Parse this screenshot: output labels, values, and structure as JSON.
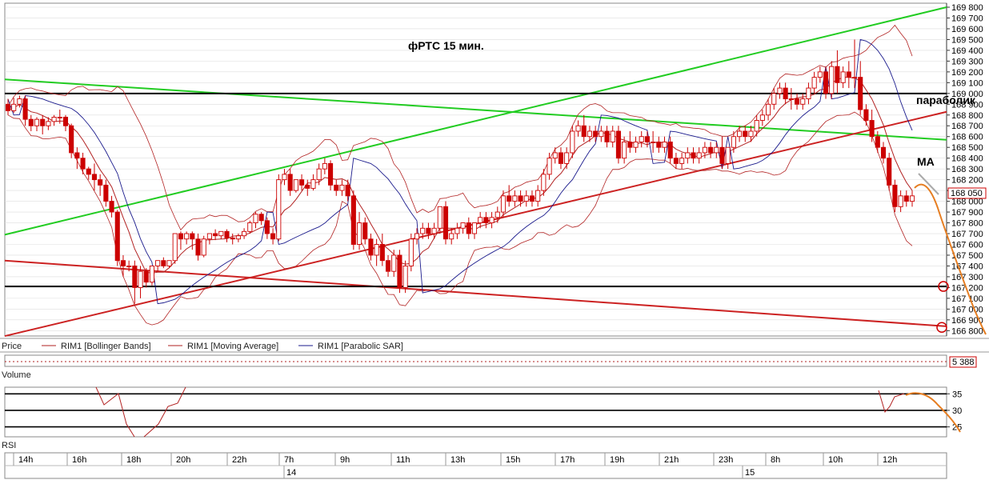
{
  "chart_data": {
    "type": "candlestick",
    "title": "фРТС   15 мин.",
    "price_axis": {
      "ticks": [
        "169 800",
        "169 700",
        "169 600",
        "169 500",
        "169 400",
        "169 300",
        "169 200",
        "169 100",
        "169 000",
        "168 900",
        "168 800",
        "168 700",
        "168 600",
        "168 500",
        "168 400",
        "168 300",
        "168 200",
        "168 100",
        "168 000",
        "167 900",
        "167 800",
        "167 700",
        "167 600",
        "167 500",
        "167 400",
        "167 300",
        "167 200",
        "167 100",
        "167 000",
        "166 900",
        "166 800"
      ],
      "range": [
        166780,
        169800
      ]
    },
    "last_price_label": "168 050",
    "volume_label": "5 388",
    "rsi_axis": {
      "ticks": [
        "35",
        "30",
        "25"
      ],
      "range": [
        22,
        37
      ]
    },
    "time_axis": {
      "hour_labels": [
        "14h",
        "16h",
        "18h",
        "20h",
        "22h",
        "7h",
        "9h",
        "11h",
        "13h",
        "15h",
        "17h",
        "19h",
        "21h",
        "23h",
        "8h",
        "10h",
        "12h"
      ],
      "day_labels": [
        "14",
        "15"
      ]
    },
    "panels": {
      "price_legend": "Price",
      "volume_title": "Volume",
      "rsi_title": "RSI"
    },
    "indicators": [
      {
        "name": "RIM1 [Bollinger Bands]",
        "color": "#b22222"
      },
      {
        "name": "RIM1 [Moving Average]",
        "color": "#b22222"
      },
      {
        "name": "RIM1 [Parabolic SAR]",
        "color": "#1a1a8c"
      }
    ],
    "annotations": {
      "parabolic": "параболик",
      "ma": "MA"
    },
    "candles": [
      {
        "o": 168900,
        "h": 168950,
        "c": 168840,
        "l": 168800
      },
      {
        "o": 168840,
        "h": 168960,
        "c": 168900,
        "l": 168820
      },
      {
        "o": 168900,
        "h": 168980,
        "c": 168950,
        "l": 168870
      },
      {
        "o": 168950,
        "h": 168980,
        "c": 168760,
        "l": 168700
      },
      {
        "o": 168760,
        "h": 168800,
        "c": 168700,
        "l": 168650
      },
      {
        "o": 168700,
        "h": 168780,
        "c": 168760,
        "l": 168650
      },
      {
        "o": 168760,
        "h": 168800,
        "c": 168700,
        "l": 168620
      },
      {
        "o": 168700,
        "h": 168780,
        "c": 168740,
        "l": 168660
      },
      {
        "o": 168740,
        "h": 168800,
        "c": 168780,
        "l": 168700
      },
      {
        "o": 168780,
        "h": 168850,
        "c": 168780,
        "l": 168720
      },
      {
        "o": 168780,
        "h": 168800,
        "c": 168700,
        "l": 168650
      },
      {
        "o": 168700,
        "h": 168720,
        "c": 168450,
        "l": 168400
      },
      {
        "o": 168450,
        "h": 168500,
        "c": 168400,
        "l": 168300
      },
      {
        "o": 168400,
        "h": 168450,
        "c": 168300,
        "l": 168250
      },
      {
        "o": 168300,
        "h": 168320,
        "c": 168250,
        "l": 168200
      },
      {
        "o": 168250,
        "h": 168350,
        "c": 168200,
        "l": 168100
      },
      {
        "o": 168200,
        "h": 168250,
        "c": 168150,
        "l": 168050
      },
      {
        "o": 168150,
        "h": 168200,
        "c": 168000,
        "l": 167950
      },
      {
        "o": 168000,
        "h": 168050,
        "c": 167900,
        "l": 167850
      },
      {
        "o": 167900,
        "h": 167920,
        "c": 167450,
        "l": 167400
      },
      {
        "o": 167450,
        "h": 167500,
        "c": 167400,
        "l": 167300
      },
      {
        "o": 167400,
        "h": 167450,
        "c": 167400,
        "l": 167350
      },
      {
        "o": 167400,
        "h": 167450,
        "c": 167200,
        "l": 167050
      },
      {
        "o": 167200,
        "h": 167400,
        "c": 167350,
        "l": 167100
      },
      {
        "o": 167350,
        "h": 167380,
        "c": 167250,
        "l": 167200
      },
      {
        "o": 167250,
        "h": 167400,
        "c": 167400,
        "l": 167220
      },
      {
        "o": 167400,
        "h": 167450,
        "c": 167450,
        "l": 167350
      },
      {
        "o": 167450,
        "h": 167480,
        "c": 167400,
        "l": 167380
      },
      {
        "o": 167400,
        "h": 167450,
        "c": 167450,
        "l": 167380
      },
      {
        "o": 167450,
        "h": 167700,
        "c": 167700,
        "l": 167420
      },
      {
        "o": 167700,
        "h": 167720,
        "c": 167650,
        "l": 167550
      },
      {
        "o": 167650,
        "h": 167720,
        "c": 167700,
        "l": 167600
      },
      {
        "o": 167700,
        "h": 167720,
        "c": 167650,
        "l": 167550
      },
      {
        "o": 167650,
        "h": 167700,
        "c": 167500,
        "l": 167450
      },
      {
        "o": 167500,
        "h": 167680,
        "c": 167650,
        "l": 167480
      },
      {
        "o": 167650,
        "h": 167700,
        "c": 167700,
        "l": 167600
      },
      {
        "o": 167700,
        "h": 167740,
        "c": 167680,
        "l": 167640
      },
      {
        "o": 167680,
        "h": 167720,
        "c": 167720,
        "l": 167650
      },
      {
        "o": 167720,
        "h": 167740,
        "c": 167660,
        "l": 167620
      },
      {
        "o": 167660,
        "h": 167700,
        "c": 167650,
        "l": 167600
      },
      {
        "o": 167650,
        "h": 167700,
        "c": 167680,
        "l": 167620
      },
      {
        "o": 167680,
        "h": 167750,
        "c": 167720,
        "l": 167650
      },
      {
        "o": 167720,
        "h": 167820,
        "c": 167800,
        "l": 167700
      },
      {
        "o": 167800,
        "h": 167900,
        "c": 167880,
        "l": 167750
      },
      {
        "o": 167880,
        "h": 167900,
        "c": 167820,
        "l": 167780
      },
      {
        "o": 167820,
        "h": 167850,
        "c": 167700,
        "l": 167650
      },
      {
        "o": 167700,
        "h": 167750,
        "c": 167650,
        "l": 167600
      },
      {
        "o": 167650,
        "h": 168250,
        "c": 168200,
        "l": 167630
      },
      {
        "o": 168200,
        "h": 168300,
        "c": 168250,
        "l": 168150
      },
      {
        "o": 168250,
        "h": 168300,
        "c": 168100,
        "l": 168050
      },
      {
        "o": 168100,
        "h": 168200,
        "c": 168200,
        "l": 168080
      },
      {
        "o": 168200,
        "h": 168250,
        "c": 168150,
        "l": 168100
      },
      {
        "o": 168150,
        "h": 168200,
        "c": 168120,
        "l": 168050
      },
      {
        "o": 168120,
        "h": 168250,
        "c": 168200,
        "l": 168100
      },
      {
        "o": 168200,
        "h": 168350,
        "c": 168300,
        "l": 168150
      },
      {
        "o": 168300,
        "h": 168400,
        "c": 168350,
        "l": 168250
      },
      {
        "o": 168350,
        "h": 168380,
        "c": 168150,
        "l": 168100
      },
      {
        "o": 168150,
        "h": 168200,
        "c": 168100,
        "l": 168050
      },
      {
        "o": 168100,
        "h": 168200,
        "c": 168150,
        "l": 168050
      },
      {
        "o": 168150,
        "h": 168200,
        "c": 168050,
        "l": 168000
      },
      {
        "o": 168050,
        "h": 168100,
        "c": 167600,
        "l": 167550
      },
      {
        "o": 167600,
        "h": 167900,
        "c": 167800,
        "l": 167550
      },
      {
        "o": 167800,
        "h": 167850,
        "c": 167650,
        "l": 167600
      },
      {
        "o": 167650,
        "h": 167700,
        "c": 167500,
        "l": 167450
      },
      {
        "o": 167500,
        "h": 167650,
        "c": 167600,
        "l": 167400
      },
      {
        "o": 167600,
        "h": 167700,
        "c": 167450,
        "l": 167400
      },
      {
        "o": 167450,
        "h": 167500,
        "c": 167350,
        "l": 167300
      },
      {
        "o": 167350,
        "h": 167550,
        "c": 167500,
        "l": 167300
      },
      {
        "o": 167500,
        "h": 167550,
        "c": 167200,
        "l": 167150
      },
      {
        "o": 167200,
        "h": 167450,
        "c": 167400,
        "l": 167150
      },
      {
        "o": 167400,
        "h": 167700,
        "c": 167650,
        "l": 167350
      },
      {
        "o": 167650,
        "h": 167750,
        "c": 167700,
        "l": 167600
      },
      {
        "o": 167700,
        "h": 167800,
        "c": 167750,
        "l": 167650
      },
      {
        "o": 167750,
        "h": 167800,
        "c": 167700,
        "l": 167650
      },
      {
        "o": 167700,
        "h": 167800,
        "c": 167750,
        "l": 167650
      },
      {
        "o": 167750,
        "h": 167950,
        "c": 167950,
        "l": 167700
      },
      {
        "o": 167950,
        "h": 168000,
        "c": 167650,
        "l": 167600
      },
      {
        "o": 167650,
        "h": 167750,
        "c": 167700,
        "l": 167600
      },
      {
        "o": 167700,
        "h": 167800,
        "c": 167750,
        "l": 167650
      },
      {
        "o": 167750,
        "h": 167800,
        "c": 167800,
        "l": 167700
      },
      {
        "o": 167800,
        "h": 167850,
        "c": 167700,
        "l": 167650
      },
      {
        "o": 167700,
        "h": 167800,
        "c": 167800,
        "l": 167650
      },
      {
        "o": 167800,
        "h": 167900,
        "c": 167850,
        "l": 167750
      },
      {
        "o": 167850,
        "h": 167900,
        "c": 167800,
        "l": 167750
      },
      {
        "o": 167800,
        "h": 167900,
        "c": 167850,
        "l": 167750
      },
      {
        "o": 167850,
        "h": 167950,
        "c": 167900,
        "l": 167800
      },
      {
        "o": 167900,
        "h": 168100,
        "c": 168050,
        "l": 167850
      },
      {
        "o": 168050,
        "h": 168150,
        "c": 168000,
        "l": 167950
      },
      {
        "o": 168000,
        "h": 168100,
        "c": 168050,
        "l": 167950
      },
      {
        "o": 168050,
        "h": 168100,
        "c": 168000,
        "l": 167950
      },
      {
        "o": 168000,
        "h": 168100,
        "c": 168050,
        "l": 167950
      },
      {
        "o": 168050,
        "h": 168100,
        "c": 168000,
        "l": 167950
      },
      {
        "o": 168000,
        "h": 168150,
        "c": 168100,
        "l": 167950
      },
      {
        "o": 168100,
        "h": 168300,
        "c": 168250,
        "l": 168050
      },
      {
        "o": 168250,
        "h": 168450,
        "c": 168400,
        "l": 168200
      },
      {
        "o": 168400,
        "h": 168500,
        "c": 168450,
        "l": 168350
      },
      {
        "o": 168450,
        "h": 168500,
        "c": 168350,
        "l": 168300
      },
      {
        "o": 168350,
        "h": 168500,
        "c": 168450,
        "l": 168300
      },
      {
        "o": 168450,
        "h": 168700,
        "c": 168650,
        "l": 168400
      },
      {
        "o": 168650,
        "h": 168750,
        "c": 168700,
        "l": 168600
      },
      {
        "o": 168700,
        "h": 168800,
        "c": 168600,
        "l": 168550
      },
      {
        "o": 168600,
        "h": 168700,
        "c": 168650,
        "l": 168550
      },
      {
        "o": 168650,
        "h": 168700,
        "c": 168600,
        "l": 168550
      },
      {
        "o": 168600,
        "h": 168700,
        "c": 168650,
        "l": 168550
      },
      {
        "o": 168650,
        "h": 168700,
        "c": 168550,
        "l": 168500
      },
      {
        "o": 168550,
        "h": 168700,
        "c": 168650,
        "l": 168500
      },
      {
        "o": 168650,
        "h": 168700,
        "c": 168400,
        "l": 168350
      },
      {
        "o": 168400,
        "h": 168600,
        "c": 168550,
        "l": 168350
      },
      {
        "o": 168550,
        "h": 168650,
        "c": 168500,
        "l": 168450
      },
      {
        "o": 168500,
        "h": 168600,
        "c": 168550,
        "l": 168450
      },
      {
        "o": 168550,
        "h": 168650,
        "c": 168600,
        "l": 168500
      },
      {
        "o": 168600,
        "h": 168650,
        "c": 168550,
        "l": 168500
      },
      {
        "o": 168550,
        "h": 168650,
        "c": 168550,
        "l": 168450
      },
      {
        "o": 168550,
        "h": 168600,
        "c": 168500,
        "l": 168450
      },
      {
        "o": 168500,
        "h": 168600,
        "c": 168550,
        "l": 168450
      },
      {
        "o": 168550,
        "h": 168600,
        "c": 168400,
        "l": 168350
      },
      {
        "o": 168400,
        "h": 168450,
        "c": 168350,
        "l": 168300
      },
      {
        "o": 168350,
        "h": 168450,
        "c": 168400,
        "l": 168300
      },
      {
        "o": 168400,
        "h": 168500,
        "c": 168450,
        "l": 168350
      },
      {
        "o": 168450,
        "h": 168500,
        "c": 168400,
        "l": 168350
      },
      {
        "o": 168400,
        "h": 168500,
        "c": 168450,
        "l": 168350
      },
      {
        "o": 168450,
        "h": 168550,
        "c": 168500,
        "l": 168400
      },
      {
        "o": 168500,
        "h": 168550,
        "c": 168450,
        "l": 168400
      },
      {
        "o": 168450,
        "h": 168550,
        "c": 168500,
        "l": 168400
      },
      {
        "o": 168500,
        "h": 168600,
        "c": 168350,
        "l": 168300
      },
      {
        "o": 168350,
        "h": 168500,
        "c": 168500,
        "l": 168300
      },
      {
        "o": 168500,
        "h": 168650,
        "c": 168600,
        "l": 168450
      },
      {
        "o": 168600,
        "h": 168700,
        "c": 168650,
        "l": 168550
      },
      {
        "o": 168650,
        "h": 168700,
        "c": 168600,
        "l": 168550
      },
      {
        "o": 168600,
        "h": 168700,
        "c": 168650,
        "l": 168550
      },
      {
        "o": 168650,
        "h": 168800,
        "c": 168750,
        "l": 168600
      },
      {
        "o": 168750,
        "h": 168850,
        "c": 168800,
        "l": 168700
      },
      {
        "o": 168800,
        "h": 168950,
        "c": 168900,
        "l": 168750
      },
      {
        "o": 168900,
        "h": 169050,
        "c": 169000,
        "l": 168850
      },
      {
        "o": 169000,
        "h": 169100,
        "c": 169050,
        "l": 168950
      },
      {
        "o": 169050,
        "h": 169100,
        "c": 168950,
        "l": 168900
      },
      {
        "o": 168950,
        "h": 169050,
        "c": 168950,
        "l": 168850
      },
      {
        "o": 168950,
        "h": 169000,
        "c": 168900,
        "l": 168850
      },
      {
        "o": 168900,
        "h": 169000,
        "c": 168950,
        "l": 168850
      },
      {
        "o": 168950,
        "h": 169100,
        "c": 169050,
        "l": 168900
      },
      {
        "o": 169050,
        "h": 169200,
        "c": 169150,
        "l": 169000
      },
      {
        "o": 169150,
        "h": 169250,
        "c": 169200,
        "l": 169100
      },
      {
        "o": 169200,
        "h": 169250,
        "c": 169000,
        "l": 168950
      },
      {
        "o": 169000,
        "h": 169300,
        "c": 169250,
        "l": 168950
      },
      {
        "o": 169250,
        "h": 169400,
        "c": 169100,
        "l": 169000
      },
      {
        "o": 169100,
        "h": 169250,
        "c": 169200,
        "l": 169050
      },
      {
        "o": 169200,
        "h": 169300,
        "c": 169150,
        "l": 169050
      },
      {
        "o": 169150,
        "h": 169500,
        "c": 169150,
        "l": 169050
      },
      {
        "o": 169150,
        "h": 169300,
        "c": 168850,
        "l": 168800
      },
      {
        "o": 168850,
        "h": 168900,
        "c": 168750,
        "l": 168700
      },
      {
        "o": 168750,
        "h": 168850,
        "c": 168600,
        "l": 168550
      },
      {
        "o": 168600,
        "h": 168650,
        "c": 168500,
        "l": 168450
      },
      {
        "o": 168500,
        "h": 168550,
        "c": 168400,
        "l": 168350
      },
      {
        "o": 168400,
        "h": 168450,
        "c": 168150,
        "l": 168100
      },
      {
        "o": 168150,
        "h": 168200,
        "c": 167950,
        "l": 167900
      },
      {
        "o": 167950,
        "h": 168100,
        "c": 168050,
        "l": 167900
      },
      {
        "o": 168050,
        "h": 168100,
        "c": 168000,
        "l": 167950
      },
      {
        "o": 168000,
        "h": 168100,
        "c": 168050,
        "l": 167950
      }
    ]
  }
}
